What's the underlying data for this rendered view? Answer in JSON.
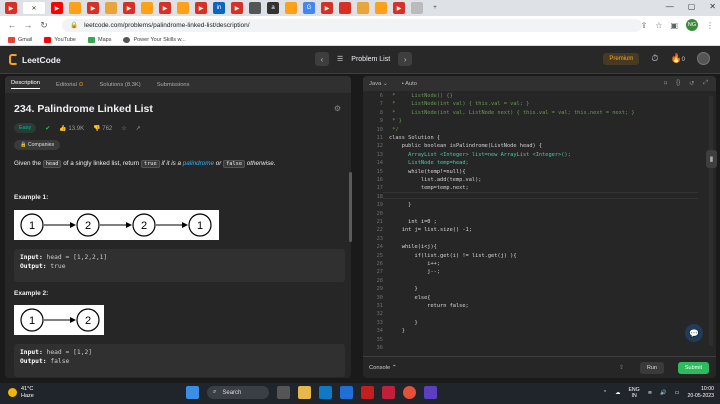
{
  "browser": {
    "url": "leetcode.com/problems/palindrome-linked-list/description/",
    "bookmarks": [
      "Gmail",
      "YouTube",
      "Maps",
      "Power Your Skills w..."
    ],
    "new_tab": "+",
    "profile": "NG"
  },
  "header": {
    "logo_text": "LeetCode",
    "problem_list": "Problem List",
    "premium": "Premium",
    "streak": "0"
  },
  "left_tabs": [
    "Description",
    "Editorial",
    "Solutions (8.3K)",
    "Submissions"
  ],
  "problem": {
    "title": "234. Palindrome Linked List",
    "difficulty": "Easy",
    "likes": "13.9K",
    "dislikes": "762",
    "companies": "Companies",
    "desc_a": "Given the",
    "desc_head": "head",
    "desc_b": "of a singly linked list, return",
    "desc_true": "true",
    "desc_c": "if it is a",
    "desc_pal": "palindrome",
    "desc_d": "or",
    "desc_false": "false",
    "desc_e": "otherwise."
  },
  "examples": [
    {
      "heading": "Example 1:",
      "nodes": [
        "1",
        "2",
        "2",
        "1"
      ],
      "input_label": "Input:",
      "input": "head = [1,2,2,1]",
      "output_label": "Output:",
      "output": "true"
    },
    {
      "heading": "Example 2:",
      "nodes": [
        "1",
        "2"
      ],
      "input_label": "Input:",
      "input": "head = [1,2]",
      "output_label": "Output:",
      "output": "false"
    }
  ],
  "editor": {
    "language": "Java",
    "mode": "Auto",
    "console": "Console",
    "run": "Run",
    "submit": "Submit",
    "lines": [
      {
        "n": "6",
        "t": " *     ListNode() {}"
      },
      {
        "n": "7",
        "t": " *     ListNode(int val) { this.val = val; }"
      },
      {
        "n": "8",
        "t": " *     ListNode(int val, ListNode next) { this.val = val; this.next = next; }"
      },
      {
        "n": "9",
        "t": " * }"
      },
      {
        "n": "10",
        "t": " */"
      },
      {
        "n": "11",
        "t": "class Solution {"
      },
      {
        "n": "12",
        "t": "    public boolean isPalindrome(ListNode head) {"
      },
      {
        "n": "13",
        "t": "      ArrayList <Integer> list=new ArrayList <Integer>();"
      },
      {
        "n": "14",
        "t": "      ListNode temp=head;"
      },
      {
        "n": "15",
        "t": "      while(temp!=null){"
      },
      {
        "n": "16",
        "t": "          list.add(temp.val);"
      },
      {
        "n": "17",
        "t": "          temp=temp.next;"
      },
      {
        "n": "18",
        "t": ""
      },
      {
        "n": "19",
        "t": "      }"
      },
      {
        "n": "20",
        "t": ""
      },
      {
        "n": "21",
        "t": "      int i=0 ;"
      },
      {
        "n": "22",
        "t": "    int j= list.size() -1;"
      },
      {
        "n": "23",
        "t": ""
      },
      {
        "n": "24",
        "t": "    while(i<j){"
      },
      {
        "n": "25",
        "t": "        if(list.get(i) != list.get(j) ){"
      },
      {
        "n": "26",
        "t": "            i++;"
      },
      {
        "n": "27",
        "t": "            j--;"
      },
      {
        "n": "28",
        "t": ""
      },
      {
        "n": "29",
        "t": "        }"
      },
      {
        "n": "30",
        "t": "        else{"
      },
      {
        "n": "31",
        "t": "            return false;"
      },
      {
        "n": "32",
        "t": ""
      },
      {
        "n": "33",
        "t": "        }"
      },
      {
        "n": "34",
        "t": "    }"
      },
      {
        "n": "35",
        "t": ""
      },
      {
        "n": "36",
        "t": ""
      }
    ]
  },
  "taskbar": {
    "temp": "41°C",
    "weather": "Haze",
    "search": "Search",
    "lang1": "ENG",
    "lang2": "IN",
    "time": "10:00",
    "date": "20-05-2023"
  },
  "colors": {
    "accent": "#ffa116",
    "easy": "#00b8a3",
    "submit": "#2cbb5d",
    "link": "#2db4ff"
  }
}
